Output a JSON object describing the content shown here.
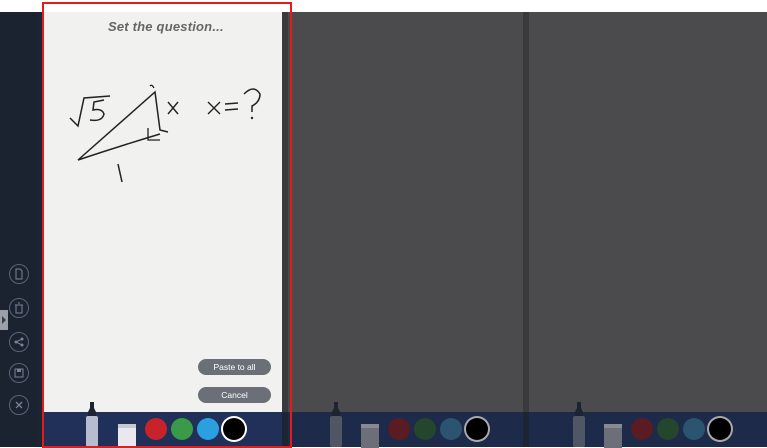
{
  "panel1": {
    "prompt": "Set the question...",
    "paste_label": "Paste to all",
    "cancel_label": "Cancel"
  },
  "sidebar_icons": [
    "document-icon",
    "trash-icon",
    "share-icon",
    "save-icon",
    "close-icon"
  ],
  "colors": {
    "red": "#c8232b",
    "green": "#3a9a4a",
    "blue": "#2aa0e0",
    "black": "#000000"
  }
}
